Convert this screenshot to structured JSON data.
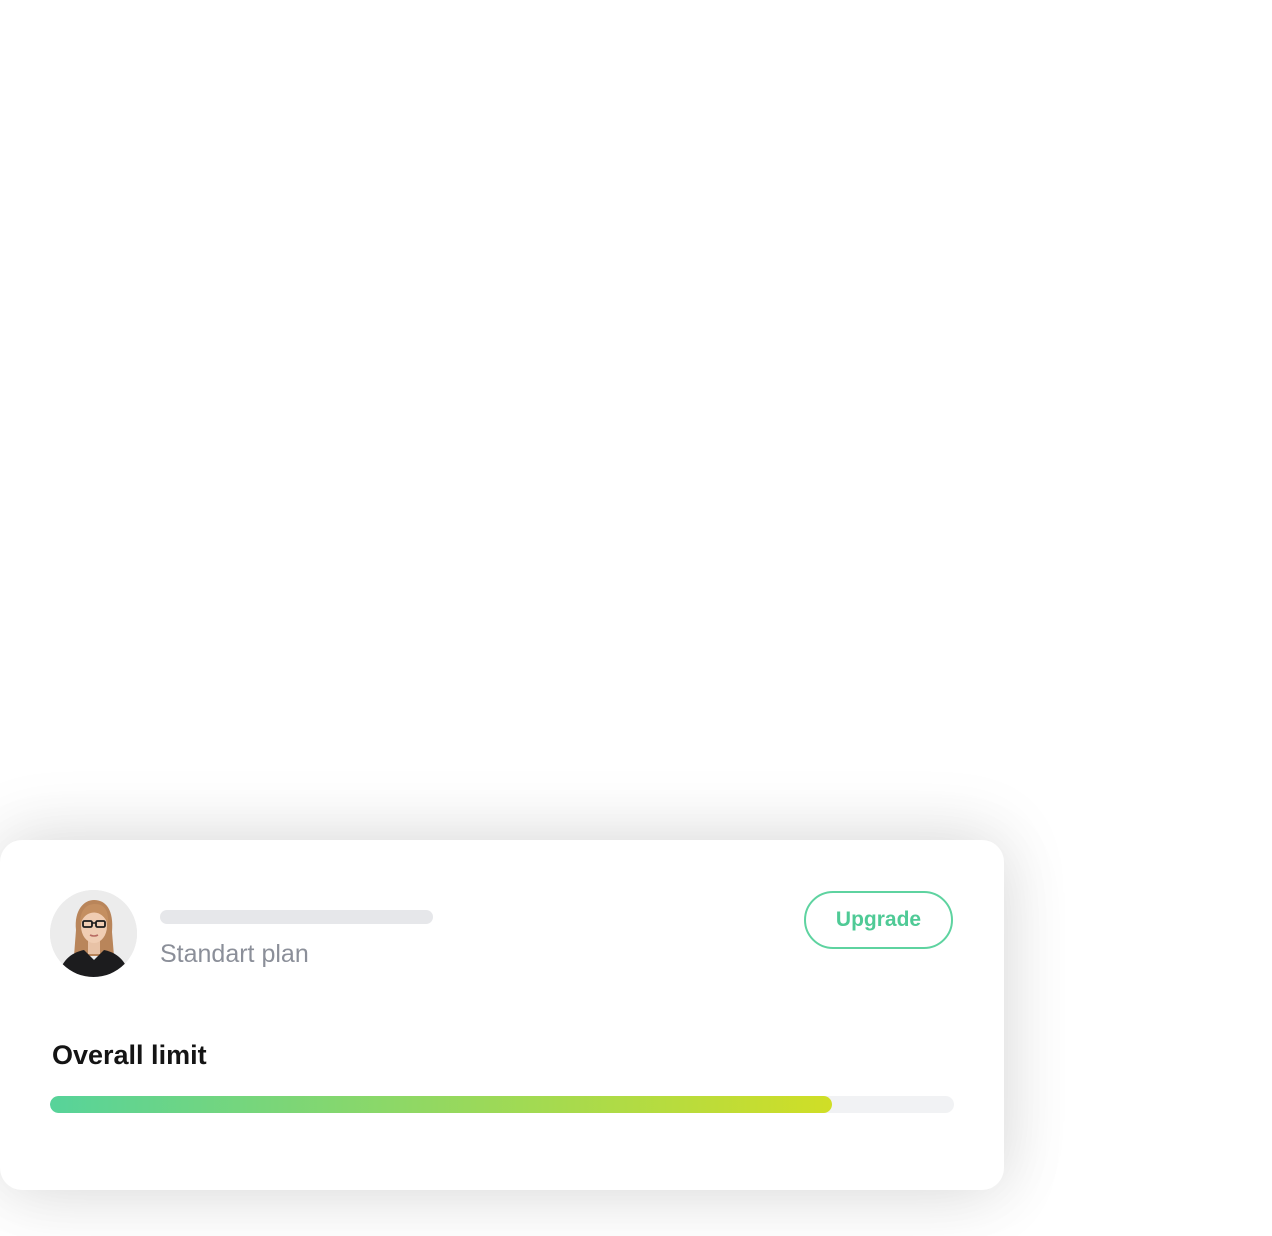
{
  "profile": {
    "avatar_alt": "user-avatar-photo",
    "plan": "Standart plan"
  },
  "actions": {
    "upgrade_label": "Upgrade"
  },
  "limit": {
    "title": "Overall limit",
    "progress_fraction": 0.865
  },
  "colors": {
    "accent": "#4fca96",
    "progress_start": "#57d39a",
    "progress_end": "#d0de26",
    "track": "#f1f2f4"
  }
}
